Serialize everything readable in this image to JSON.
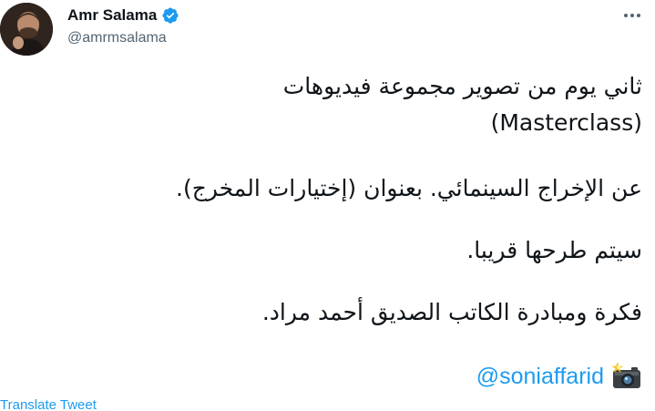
{
  "author": {
    "display_name": "Amr Salama",
    "handle": "@amrmsalama",
    "verified": true
  },
  "icons": {
    "verified": "verified-badge-icon",
    "more": "more-options-icon",
    "camera": "camera-with-flash-icon"
  },
  "tweet": {
    "lines": [
      "ثاني يوم من تصوير مجموعة فيديوهات",
      "(Masterclass)",
      "عن الإخراج السينمائي. بعنوان (إختيارات المخرج).",
      "سيتم طرحها قريبا.",
      "فكرة ومبادرة الكاتب الصديق أحمد مراد."
    ],
    "mention": "@soniaffarid"
  },
  "translate_label": "Translate Tweet",
  "colors": {
    "accent": "#1d9bf0",
    "text": "#0f1419",
    "secondary": "#536471"
  }
}
